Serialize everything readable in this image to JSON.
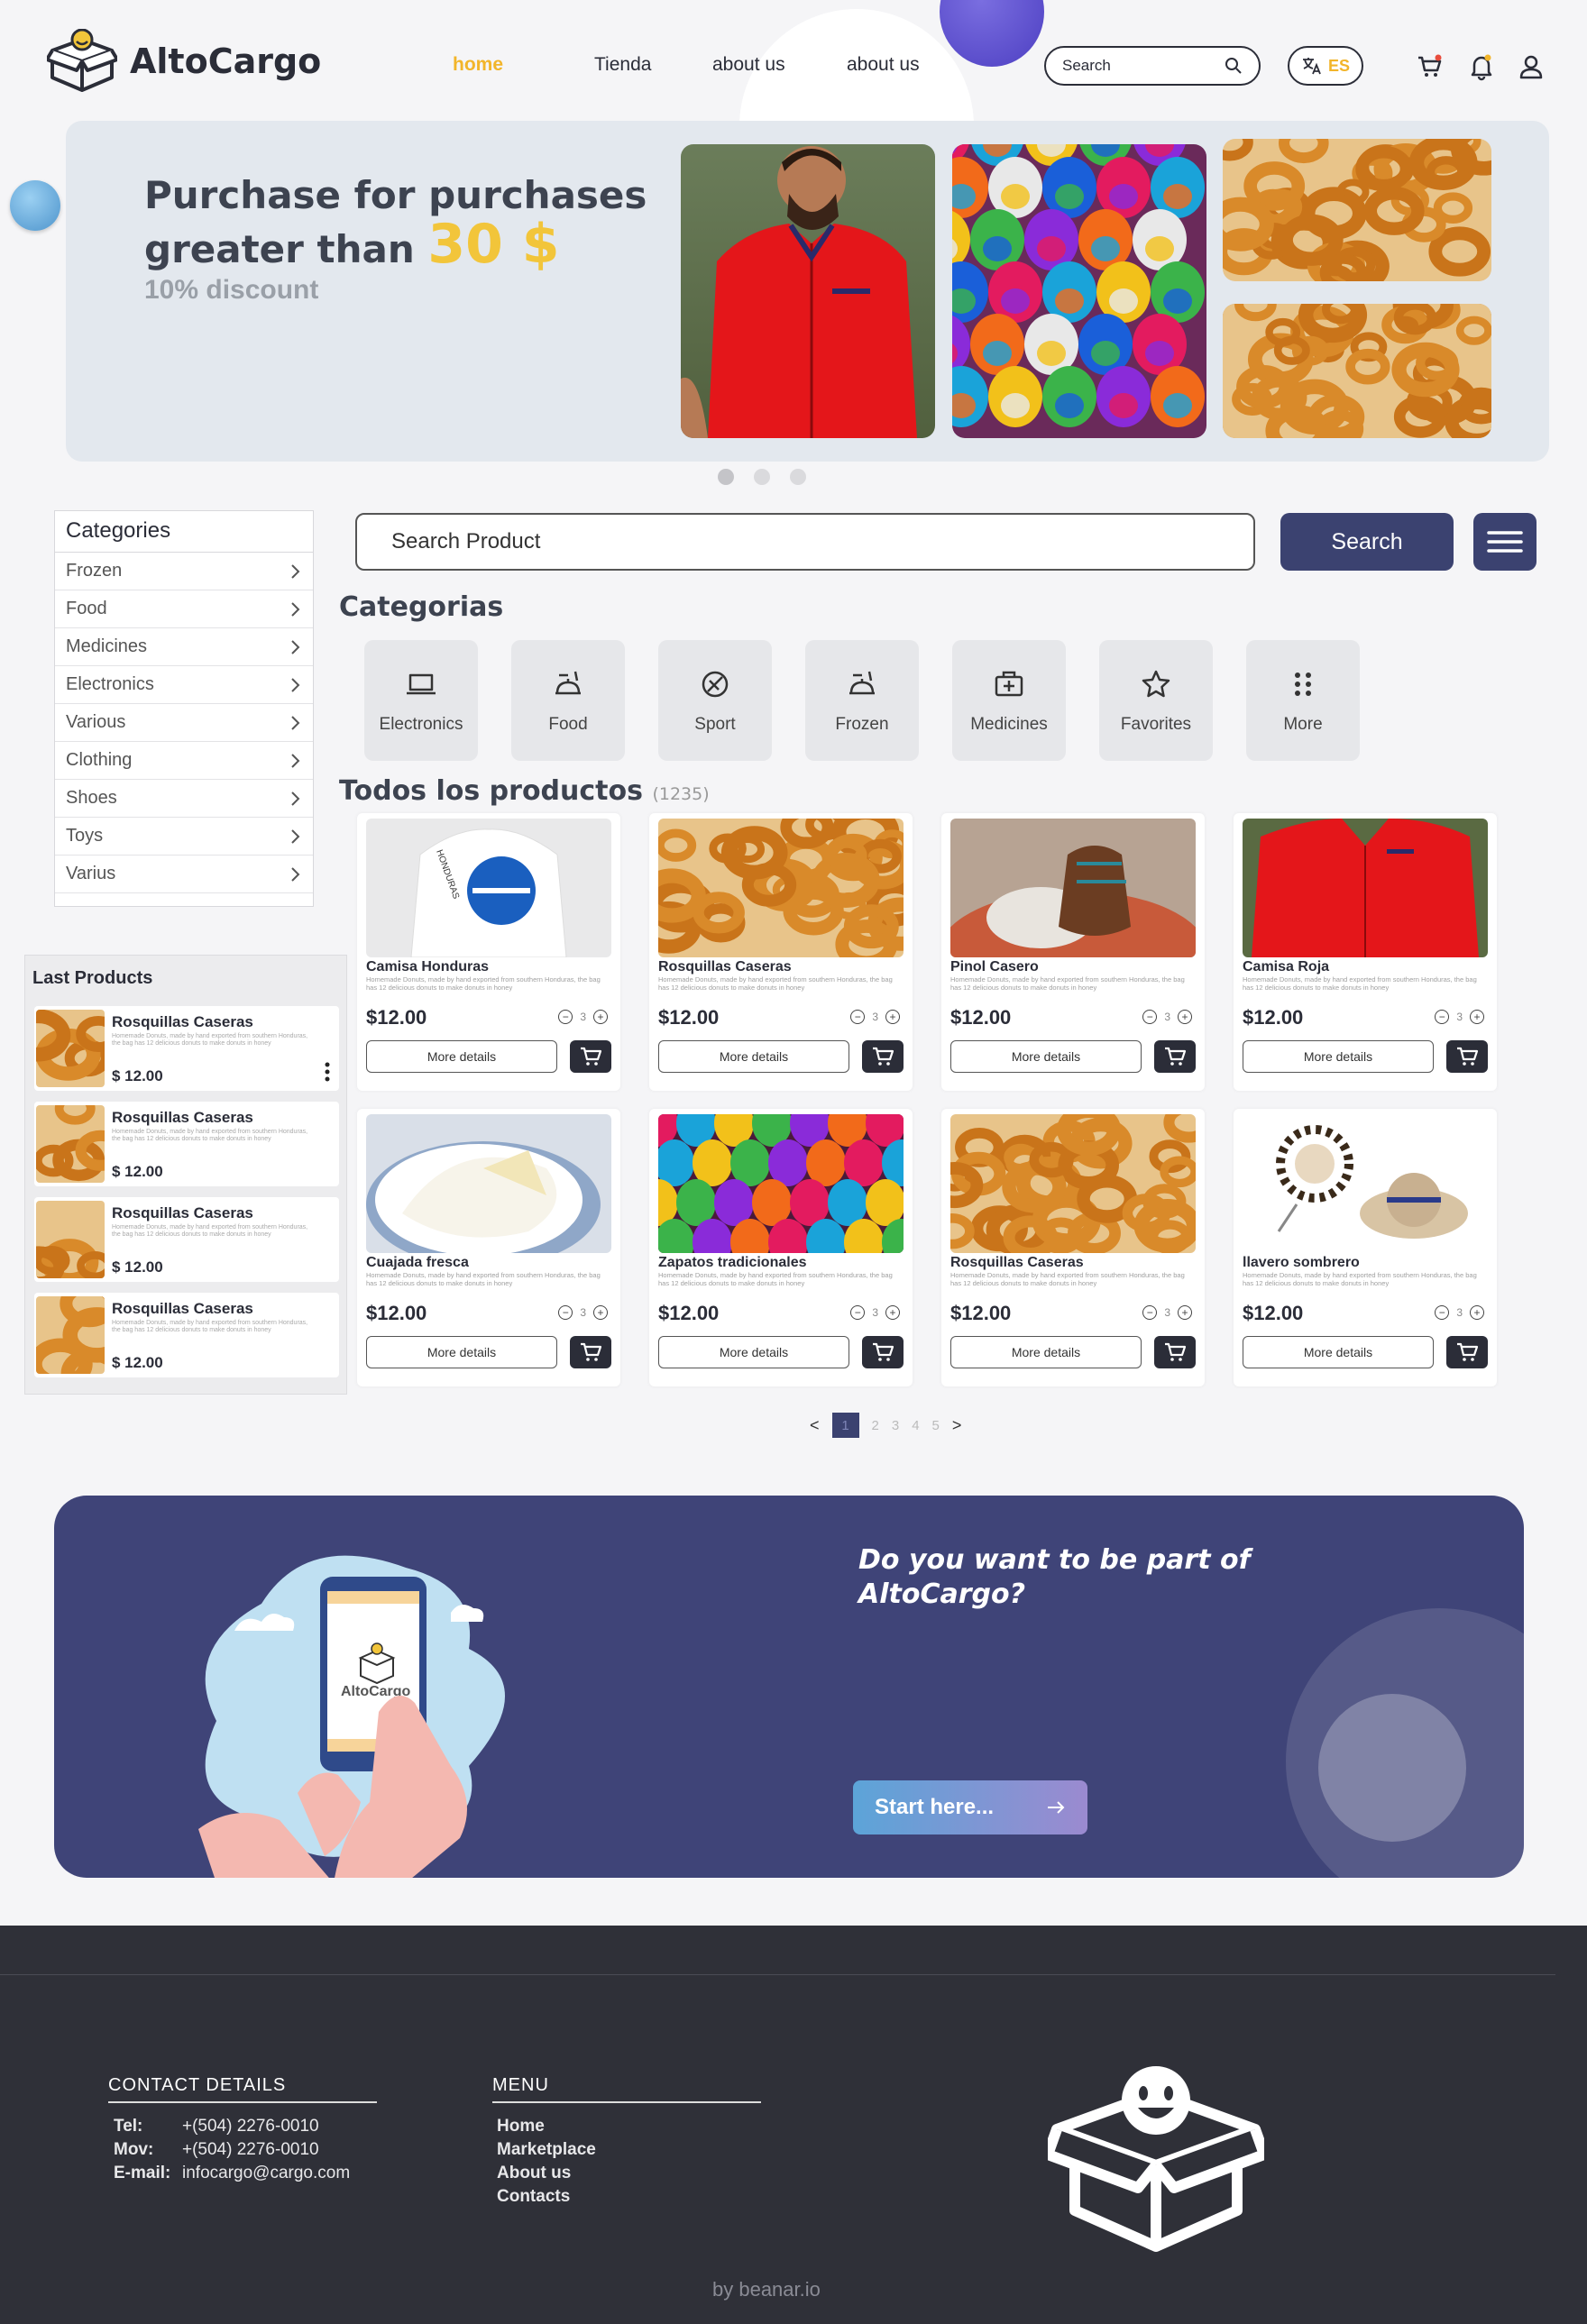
{
  "header": {
    "brand": "AltoCargo",
    "nav": [
      "home",
      "Tienda",
      "about us",
      "about us"
    ],
    "search_label": "Search",
    "lang": "ES"
  },
  "hero": {
    "line1": "Purchase for purchases",
    "line2": "greater than",
    "amount": "30 $",
    "discount": "10% discount",
    "slides_count": 3,
    "active_slide": 0
  },
  "categories_sidebar": {
    "title": "Categories",
    "items": [
      "Frozen",
      "Food",
      "Medicines",
      "Electronics",
      "Various",
      "Clothing",
      "Shoes",
      "Toys",
      "Varius"
    ]
  },
  "product_search": {
    "placeholder": "Search Product",
    "button": "Search"
  },
  "categorias": {
    "title": "Categorias",
    "tiles": [
      "Electronics",
      "Food",
      "Sport",
      "Frozen",
      "Medicines",
      "Favorites",
      "More"
    ]
  },
  "products": {
    "title": "Todos los productos",
    "count": "(1235)",
    "desc": "Homemade Donuts, made by hand exported from southern Honduras, the bag has 12 delicious donuts to make donuts in honey",
    "more_label": "More details",
    "items": [
      {
        "name": "Camisa Honduras",
        "price": "$12.00",
        "qty": "3"
      },
      {
        "name": "Rosquillas Caseras",
        "price": "$12.00",
        "qty": "3"
      },
      {
        "name": "Pinol Casero",
        "price": "$12.00",
        "qty": "3"
      },
      {
        "name": "Camisa Roja",
        "price": "$12.00",
        "qty": "3"
      },
      {
        "name": "Cuajada fresca",
        "price": "$12.00",
        "qty": "3"
      },
      {
        "name": "Zapatos tradicionales",
        "price": "$12.00",
        "qty": "3"
      },
      {
        "name": "Rosquillas Caseras",
        "price": "$12.00",
        "qty": "3"
      },
      {
        "name": "llavero sombrero",
        "price": "$12.00",
        "qty": "3"
      }
    ]
  },
  "pagination": {
    "pages": [
      "1",
      "2",
      "3",
      "4",
      "5"
    ],
    "active": "1",
    "prev": "<",
    "next": ">"
  },
  "last_products": {
    "title": "Last Products",
    "items": [
      {
        "name": "Rosquillas Caseras",
        "price": "$  12.00"
      },
      {
        "name": "Rosquillas Caseras",
        "price": "$  12.00"
      },
      {
        "name": "Rosquillas Caseras",
        "price": "$  12.00"
      },
      {
        "name": "Rosquillas Caseras",
        "price": "$  12.00"
      }
    ]
  },
  "banner": {
    "title_line1": "Do you want to be part of",
    "title_line2": "AltoCargo?",
    "button": "Start here...",
    "phone_brand": "AltoCargo"
  },
  "footer": {
    "contact_title": "CONTACT DETAILS",
    "tel_label": "Tel:",
    "tel": "+(504) 2276-0010",
    "mov_label": "Mov:",
    "mov": "+(504) 2276-0010",
    "email_label": "E-mail:",
    "email": "infocargo@cargo.com",
    "menu_title": "MENU",
    "menu": [
      "Home",
      "Marketplace",
      "About us",
      "Contacts"
    ],
    "credit": "by beanar.io"
  },
  "colors": {
    "accent": "#f2b52a",
    "primary": "#3b4270",
    "footer": "#2f3038"
  }
}
